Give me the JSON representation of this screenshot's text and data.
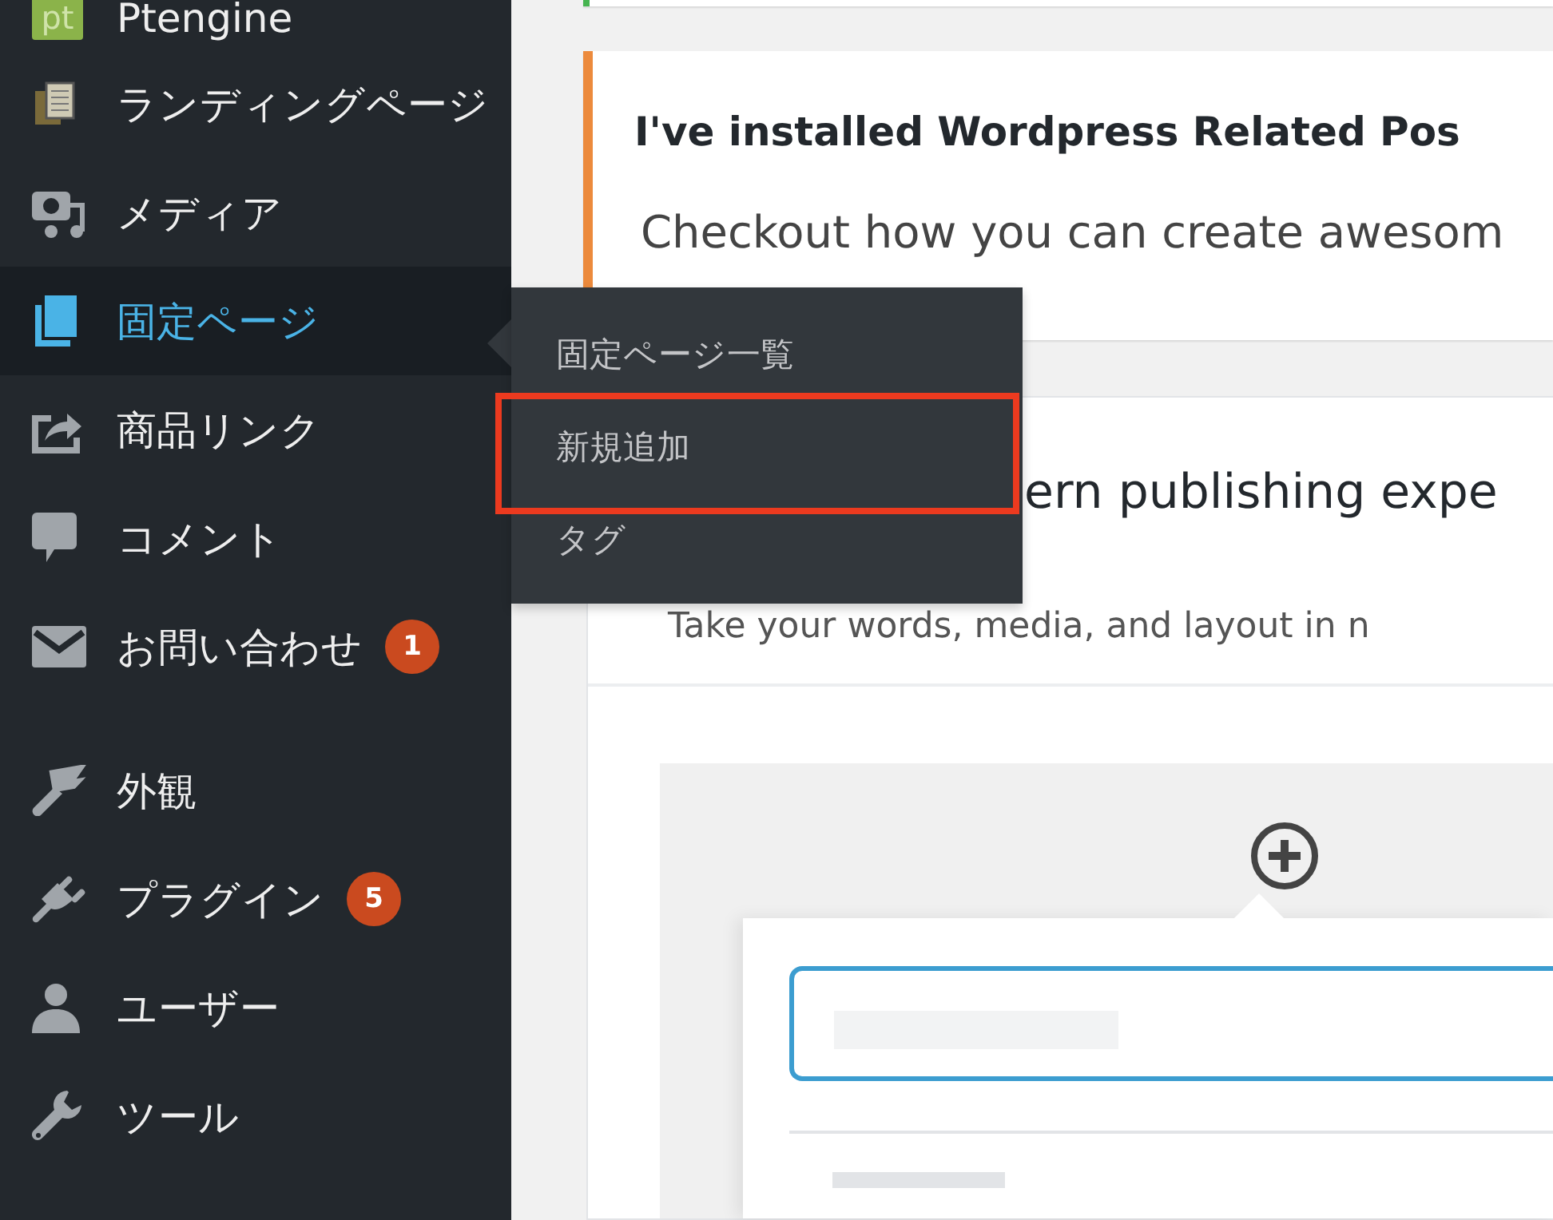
{
  "sidebar": {
    "groups": [
      [
        {
          "label": "Ptengine",
          "selected": false,
          "logo_text": "pt"
        },
        {
          "label": "ランディングページ",
          "selected": false
        },
        {
          "label": "メディア",
          "selected": false
        },
        {
          "label": "固定ページ",
          "selected": true
        },
        {
          "label": "商品リンク",
          "selected": false
        },
        {
          "label": "コメント",
          "selected": false
        },
        {
          "label": "お問い合わせ",
          "selected": false,
          "badge": "1"
        }
      ],
      [
        {
          "label": "外観",
          "selected": false
        },
        {
          "label": "プラグイン",
          "selected": false,
          "badge": "5"
        },
        {
          "label": "ユーザー",
          "selected": false
        },
        {
          "label": "ツール",
          "selected": false
        }
      ]
    ]
  },
  "flyout": {
    "items": [
      {
        "label": "固定ページ一覧",
        "annotated": false
      },
      {
        "label": "新規追加",
        "annotated": true
      },
      {
        "label": "タグ",
        "annotated": false
      }
    ]
  },
  "notice": {
    "title": "I've installed Wordpress Related Pos",
    "body": "Checkout how you can create awesom"
  },
  "welcome": {
    "heading": "ern publishing expe",
    "subtext": "Take your words, media, and layout in n"
  }
}
